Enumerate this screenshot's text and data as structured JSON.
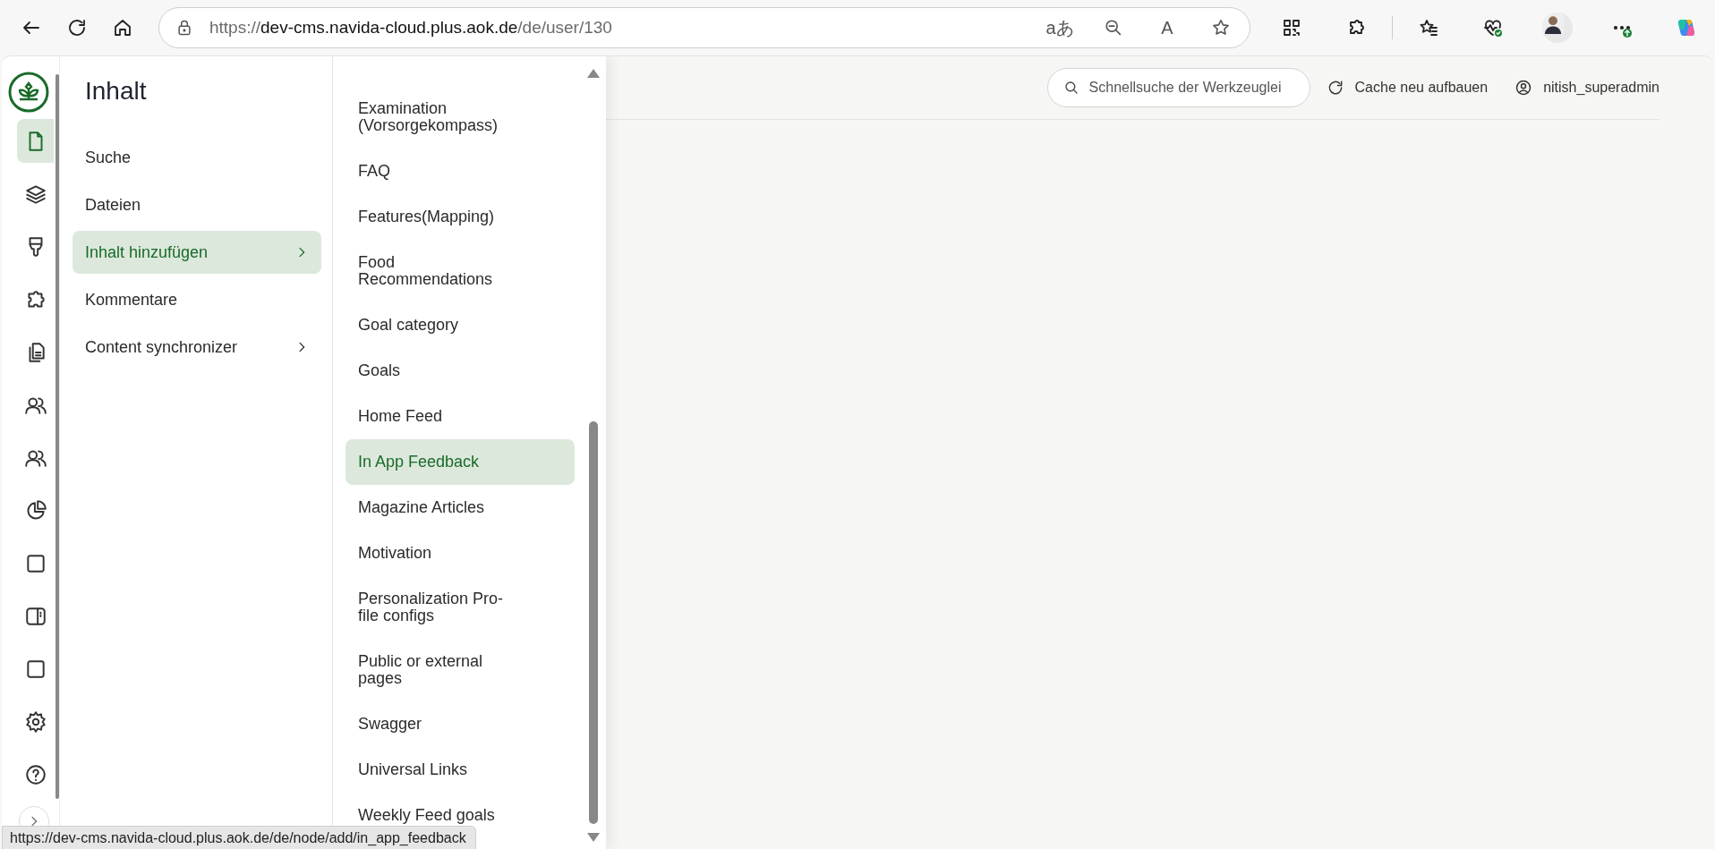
{
  "browser": {
    "url": {
      "scheme": "https://",
      "host": "dev-cms.navida-cloud.plus.aok.de",
      "path": "/de/user/130"
    },
    "translate_glyph": "aあ",
    "read_aloud_glyph": "A"
  },
  "rail": {
    "items": [
      {
        "selected": true
      },
      {
        "selected": false
      },
      {
        "selected": false
      },
      {
        "selected": false
      },
      {
        "selected": false
      },
      {
        "selected": false
      },
      {
        "selected": false
      },
      {
        "selected": false
      },
      {
        "selected": false
      },
      {
        "selected": false
      },
      {
        "selected": false
      },
      {
        "selected": false
      },
      {
        "selected": false
      }
    ]
  },
  "menu": {
    "title": "Inhalt",
    "items": [
      {
        "label": "Suche",
        "selected": false,
        "has_submenu": false
      },
      {
        "label": "Dateien",
        "selected": false,
        "has_submenu": false
      },
      {
        "label": "Inhalt hinzufügen",
        "selected": true,
        "has_submenu": true
      },
      {
        "label": "Kommentare",
        "selected": false,
        "has_submenu": false
      },
      {
        "label": "Content synchronizer",
        "selected": false,
        "has_submenu": true
      }
    ]
  },
  "submenu": {
    "items": [
      {
        "label": "Examination\n(Vorsorgekompass)",
        "selected": false
      },
      {
        "label": "FAQ",
        "selected": false
      },
      {
        "label": "Features(Mapping)",
        "selected": false
      },
      {
        "label": "Food\nRecommendations",
        "selected": false
      },
      {
        "label": "Goal category",
        "selected": false
      },
      {
        "label": "Goals",
        "selected": false
      },
      {
        "label": "Home Feed",
        "selected": false
      },
      {
        "label": "In App Feedback",
        "selected": true
      },
      {
        "label": "Magazine Articles",
        "selected": false
      },
      {
        "label": "Motivation",
        "selected": false
      },
      {
        "label": "Personalization Pro-\nfile configs",
        "selected": false
      },
      {
        "label": "Public or external\npages",
        "selected": false
      },
      {
        "label": "Swagger",
        "selected": false
      },
      {
        "label": "Universal Links",
        "selected": false
      },
      {
        "label": "Weekly Feed goals",
        "selected": false
      }
    ]
  },
  "header": {
    "search": {
      "placeholder": "Schnellsuche der Werkzeuglei"
    },
    "cache_button": "Cache neu aufbauen",
    "user": "nitish_superadmin"
  },
  "status_url": "https://dev-cms.navida-cloud.plus.aok.de/de/node/add/in_app_feedback"
}
